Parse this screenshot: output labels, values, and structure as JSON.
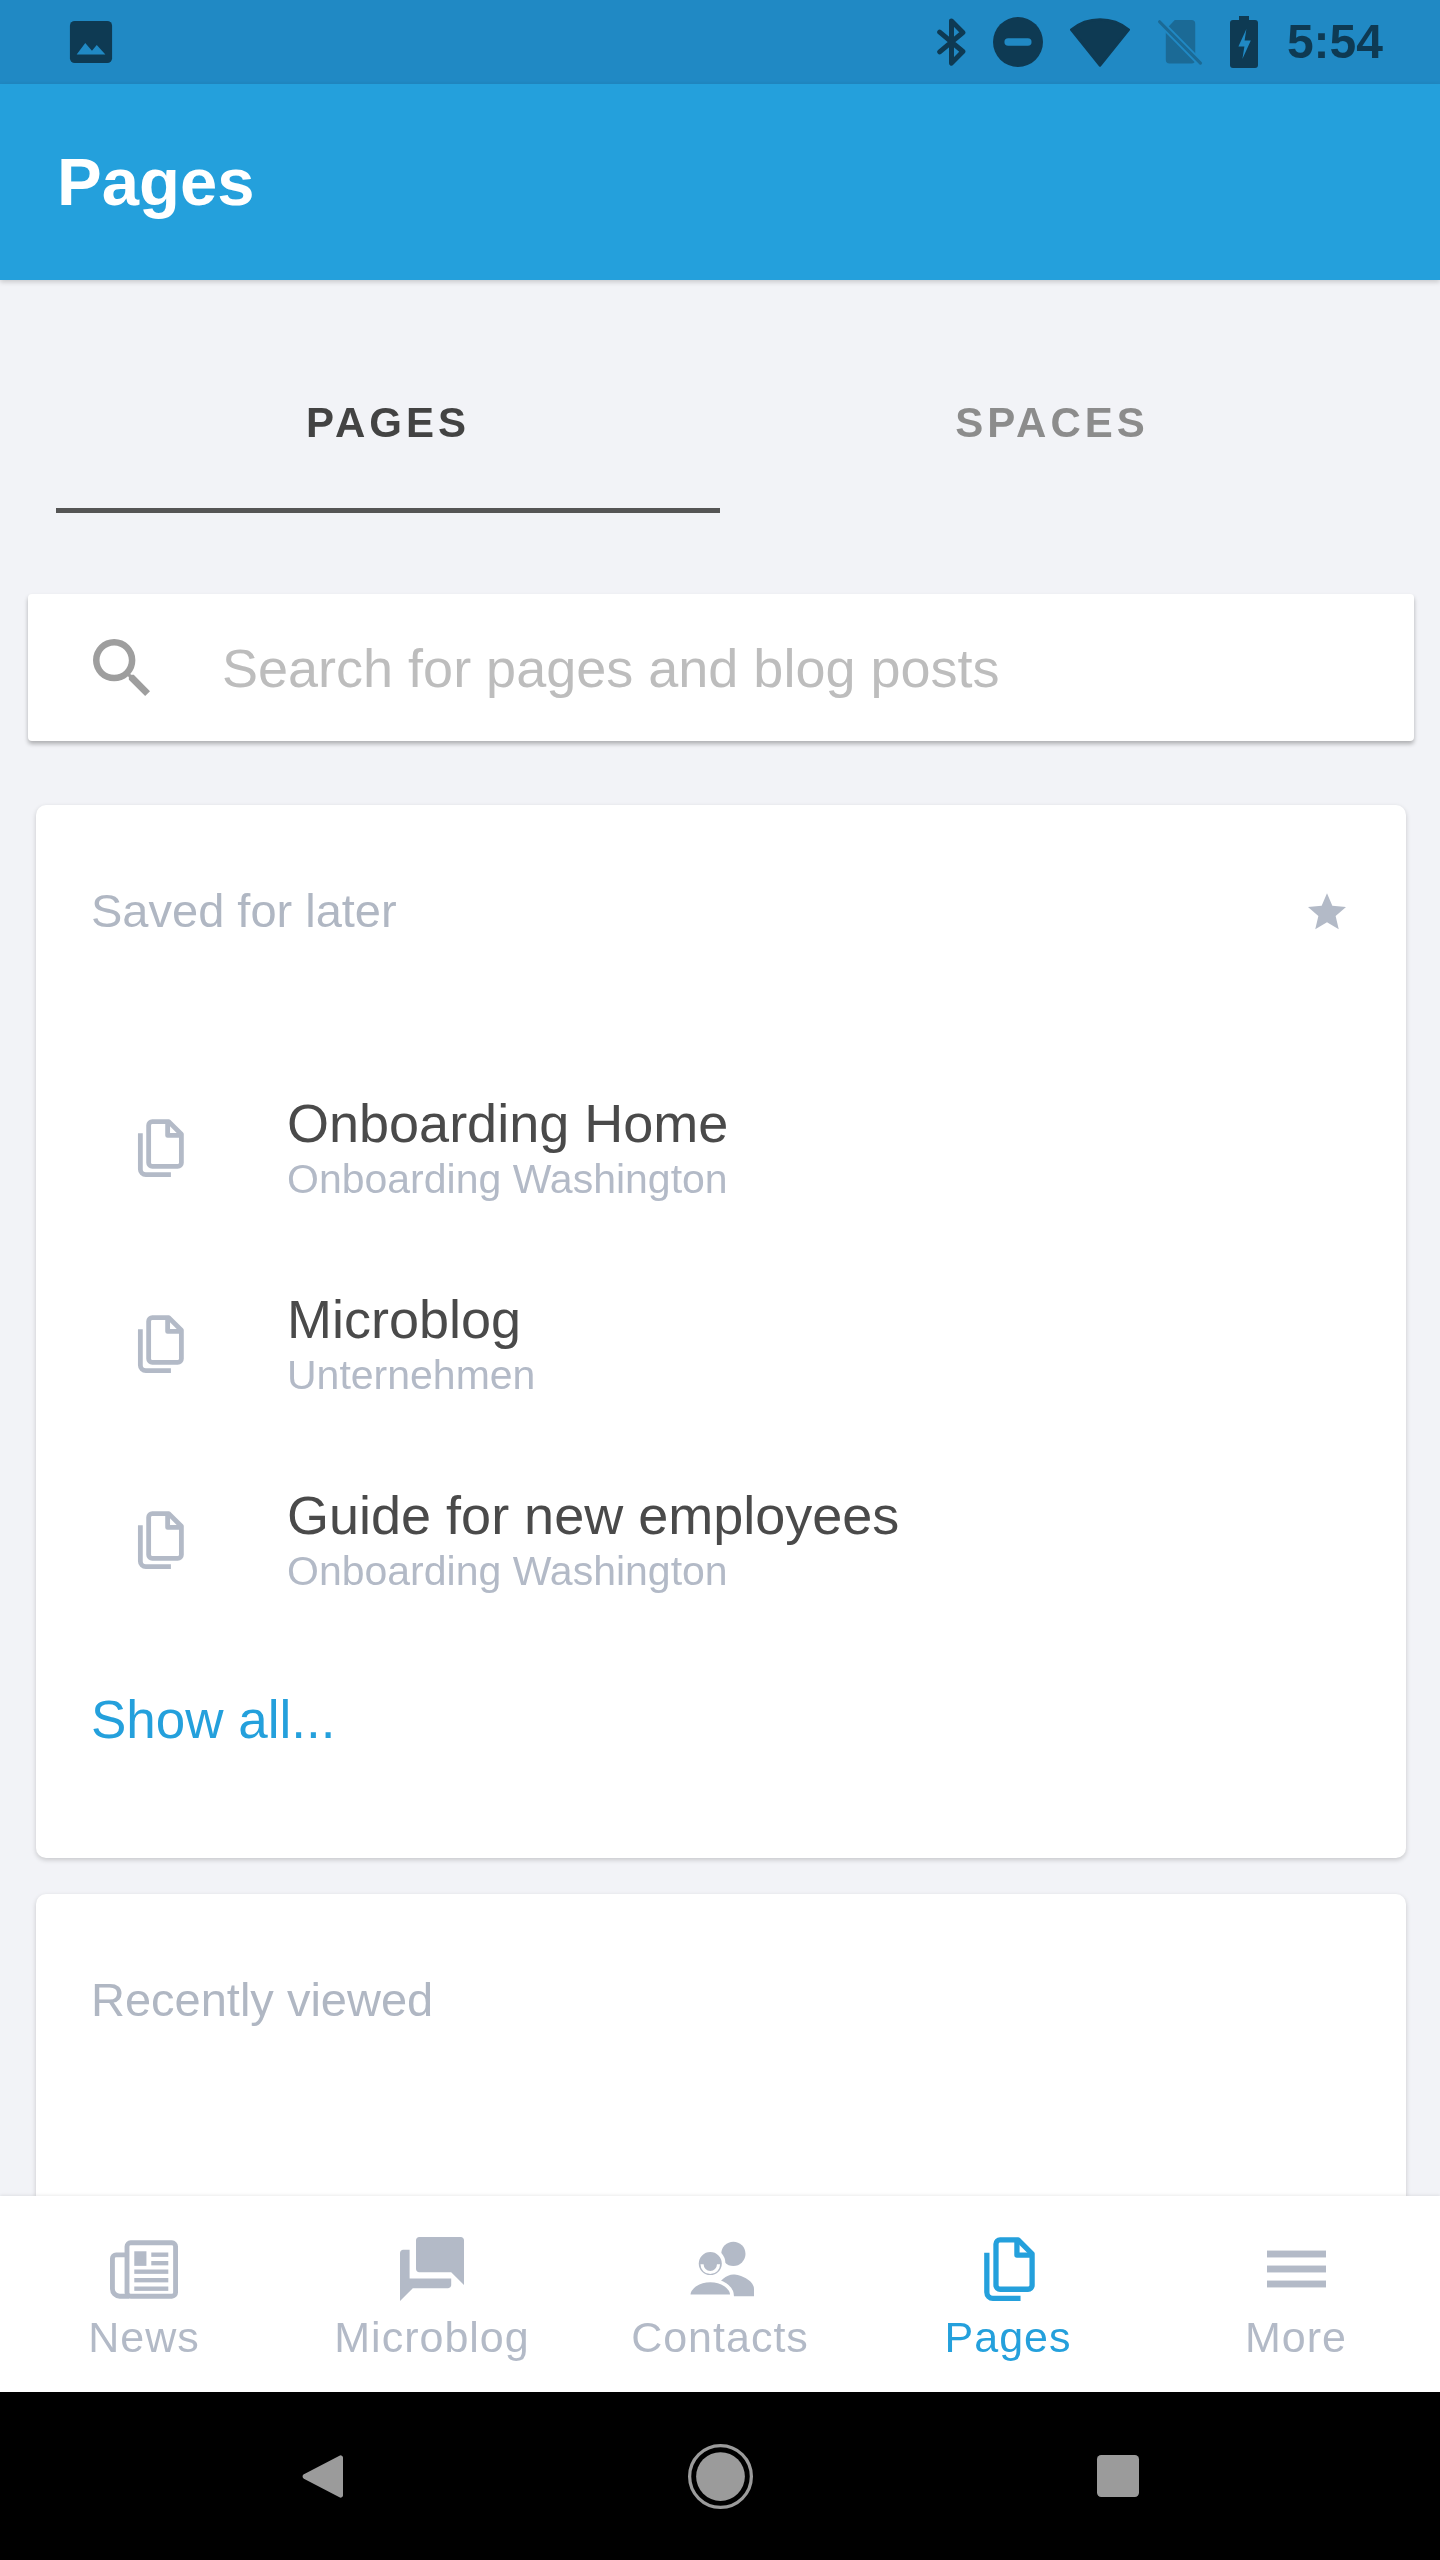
{
  "status_bar": {
    "time": "5:54"
  },
  "app_bar": {
    "title": "Pages"
  },
  "tabs": [
    {
      "label": "PAGES",
      "selected": true
    },
    {
      "label": "SPACES",
      "selected": false
    }
  ],
  "search": {
    "placeholder": "Search for pages and blog posts"
  },
  "saved_for_later": {
    "title": "Saved for later",
    "items": [
      {
        "title": "Onboarding Home",
        "space": "Onboarding Washington"
      },
      {
        "title": "Microblog",
        "space": "Unternehmen"
      },
      {
        "title": "Guide for new employees",
        "space": "Onboarding Washington"
      }
    ],
    "show_all": "Show all..."
  },
  "recently_viewed": {
    "title": "Recently viewed"
  },
  "bottom_nav": [
    {
      "label": "News",
      "selected": false
    },
    {
      "label": "Microblog",
      "selected": false
    },
    {
      "label": "Contacts",
      "selected": false
    },
    {
      "label": "Pages",
      "selected": true
    },
    {
      "label": "More",
      "selected": false
    }
  ]
}
